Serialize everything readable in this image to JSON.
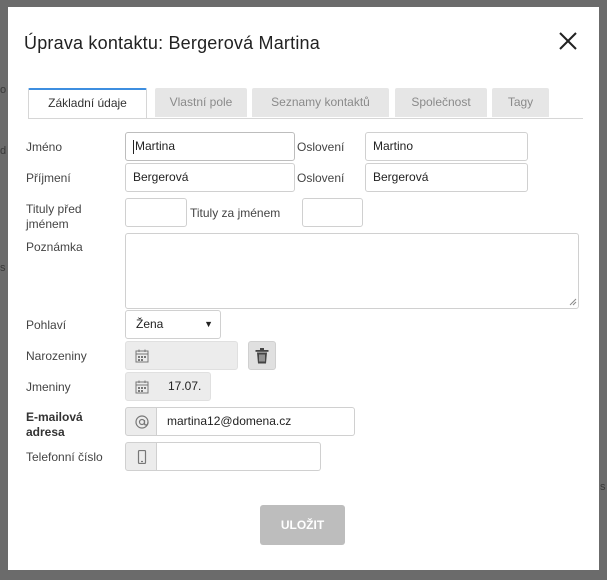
{
  "dialog": {
    "title": "Úprava kontaktu: Bergerová Martina"
  },
  "tabs": [
    {
      "label": "Základní údaje"
    },
    {
      "label": "Vlastní pole"
    },
    {
      "label": "Seznamy kontaktů"
    },
    {
      "label": "Společnost"
    },
    {
      "label": "Tagy"
    }
  ],
  "form": {
    "first_name": {
      "label": "Jméno",
      "value": "Martina"
    },
    "first_salutation": {
      "label": "Oslovení",
      "value": "Martino"
    },
    "last_name": {
      "label": "Příjmení",
      "value": "Bergerová"
    },
    "last_salutation": {
      "label": "Oslovení",
      "value": "Bergerová"
    },
    "title_before": {
      "label_line1": "Tituly před",
      "label_line2": "jménem",
      "value": ""
    },
    "title_after": {
      "label": "Tituly za jménem",
      "value": ""
    },
    "note": {
      "label": "Poznámka",
      "value": ""
    },
    "gender": {
      "label": "Pohlaví",
      "value": "Žena"
    },
    "birthday": {
      "label": "Narozeniny",
      "value": ""
    },
    "nameday": {
      "label": "Jmeniny",
      "value": "17.07."
    },
    "email": {
      "label_line1": "E-mailová",
      "label_line2": "adresa",
      "value": "martina12@domena.cz"
    },
    "phone": {
      "label": "Telefonní číslo",
      "value": ""
    }
  },
  "actions": {
    "save_label": "ULOŽIT"
  },
  "colors": {
    "overlay": "#6b6b6b",
    "tab_active_border": "#3d8ee0",
    "tab_inactive_bg": "#e6e6e6",
    "save_button_bg": "#bdbdbd"
  }
}
